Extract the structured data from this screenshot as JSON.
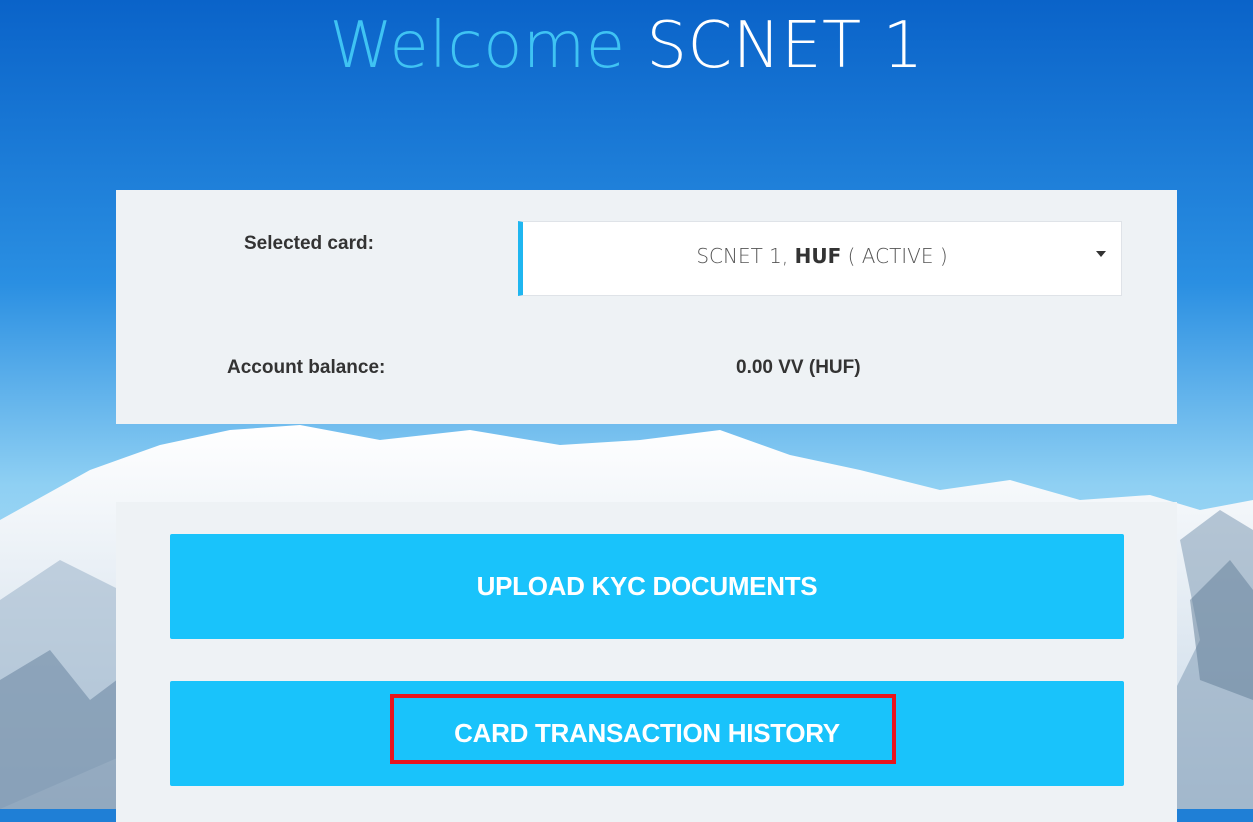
{
  "header": {
    "welcome": "Welcome",
    "user_name": "SCNET 1"
  },
  "card_panel": {
    "selected_card_label": "Selected card:",
    "selected_card": {
      "name": "SCNET 1,",
      "currency": "HUF",
      "status": "( ACTIVE )"
    },
    "account_balance_label": "Account balance:",
    "account_balance_value": "0.00 VV (HUF)"
  },
  "actions": {
    "upload_kyc": "UPLOAD KYC DOCUMENTS",
    "card_history": "CARD TRANSACTION HISTORY"
  },
  "colors": {
    "accent": "#19c3fb",
    "welcome_text": "#3fc3f3",
    "highlight_border": "#e8151b",
    "panel_bg": "#eef2f5"
  }
}
